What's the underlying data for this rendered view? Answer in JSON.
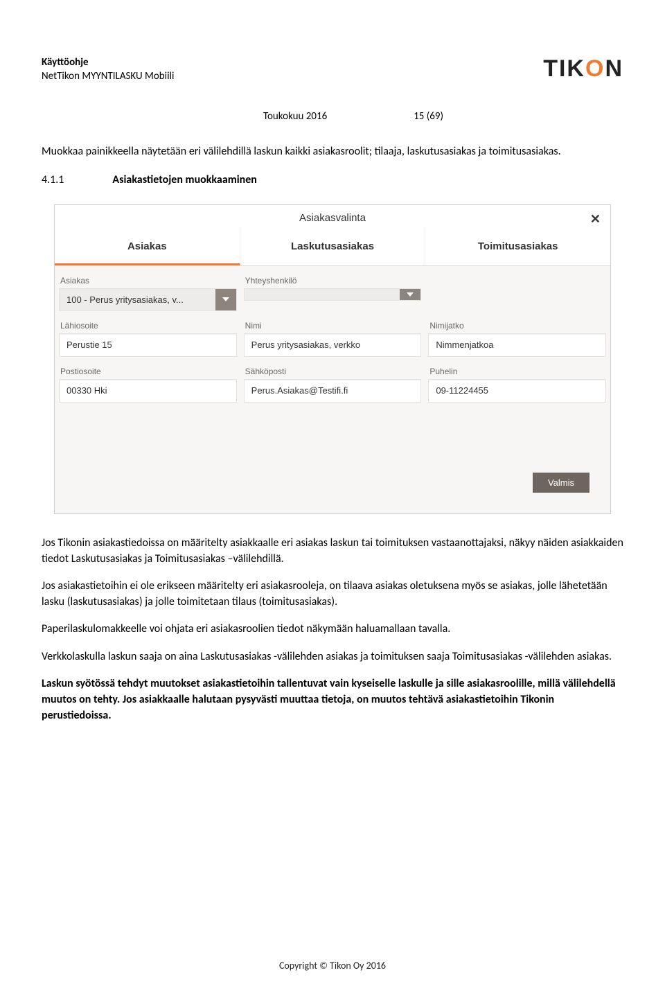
{
  "header": {
    "title_bold": "Käyttöohje",
    "subtitle": "NetTikon MYYNTILASKU Mobiili",
    "logo_t": "TIK",
    "logo_o": "O",
    "logo_n": "N",
    "date": "Toukokuu 2016",
    "pages": "15 (69)"
  },
  "intro": "Muokkaa painikkeella näytetään eri välilehdillä laskun kaikki asiakasroolit; tilaaja, laskutusasiakas ja toimitusasiakas.",
  "section": {
    "num": "4.1.1",
    "title": "Asiakastietojen muokkaaminen"
  },
  "ui": {
    "title": "Asiakasvalinta",
    "tabs": [
      "Asiakas",
      "Laskutusasiakas",
      "Toimitusasiakas"
    ],
    "labels": {
      "asiakas": "Asiakas",
      "yhteyshenkilo": "Yhteyshenkilö",
      "lahiosoite": "Lähiosoite",
      "nimi": "Nimi",
      "nimijatko": "Nimijatko",
      "postiosoite": "Postiosoite",
      "sahkoposti": "Sähköposti",
      "puhelin": "Puhelin"
    },
    "values": {
      "asiakas_select": "100 - Perus yritysasiakas, v...",
      "yhteys_select": "",
      "lahiosoite": "Perustie 15",
      "nimi": "Perus yritysasiakas, verkko",
      "nimijatko": "Nimmenjatkoa",
      "postiosoite": "00330 Hki",
      "sahkoposti": "Perus.Asiakas@Testifi.fi",
      "puhelin": "09-11224455"
    },
    "valmis": "Valmis"
  },
  "paragraphs": {
    "p1": "Jos Tikonin asiakastiedoissa on määritelty asiakkaalle eri asiakas laskun tai toimituksen vastaanottajaksi, näkyy näiden asiakkaiden tiedot Laskutusasiakas ja Toimitusasiakas –välilehdillä.",
    "p2": "Jos asiakastietoihin ei ole erikseen määritelty eri asiakasrooleja, on tilaava asiakas oletuksena myös se asiakas, jolle lähetetään lasku (laskutusasiakas) ja jolle toimitetaan tilaus (toimitusasiakas).",
    "p3": "Paperilaskulomakkeelle voi ohjata eri asiakasroolien tiedot näkymään haluamallaan tavalla.",
    "p4": "Verkkolaskulla laskun saaja on aina Laskutusasiakas -välilehden asiakas ja toimituksen saaja Toimitusasiakas -välilehden asiakas.",
    "p5_bold": "Laskun syötössä tehdyt muutokset asiakastietoihin tallentuvat vain kyseiselle laskulle ja sille asiakasroolille, millä välilehdellä muutos on tehty.  Jos asiakkaalle halutaan pysyvästi muuttaa tietoja, on muutos tehtävä asiakastietoihin Tikonin perustiedoissa."
  },
  "footer": "Copyright © Tikon Oy 2016"
}
